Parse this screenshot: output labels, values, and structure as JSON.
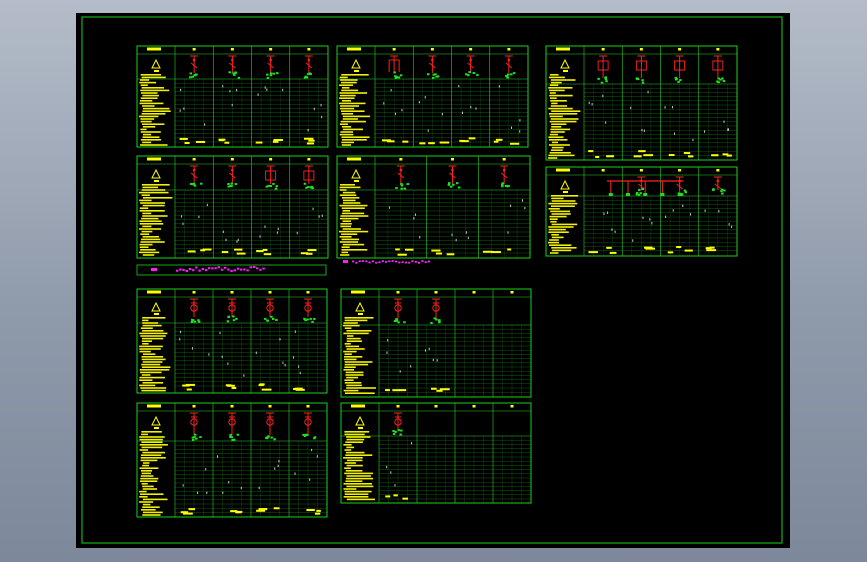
{
  "viewport": {
    "background": "#000000"
  },
  "colors": {
    "frame": "#19d219",
    "grid": "#2bd02b",
    "symbol_red": "#ff2020",
    "symbol_green": "#1fe01f",
    "text_yellow": "#ffff00",
    "text_magenta": "#ff1cff",
    "tick_white": "#d9d9d9"
  },
  "drawing": {
    "panel_groups": [
      {
        "id": "group-1",
        "sheets": 4
      },
      {
        "id": "group-2",
        "sheets": 2
      },
      {
        "id": "group-3",
        "sheets": 4
      }
    ],
    "legend_rows": [
      {
        "id": "note-row-1",
        "color": "magenta"
      },
      {
        "id": "note-row-2",
        "color": "magenta"
      }
    ]
  }
}
